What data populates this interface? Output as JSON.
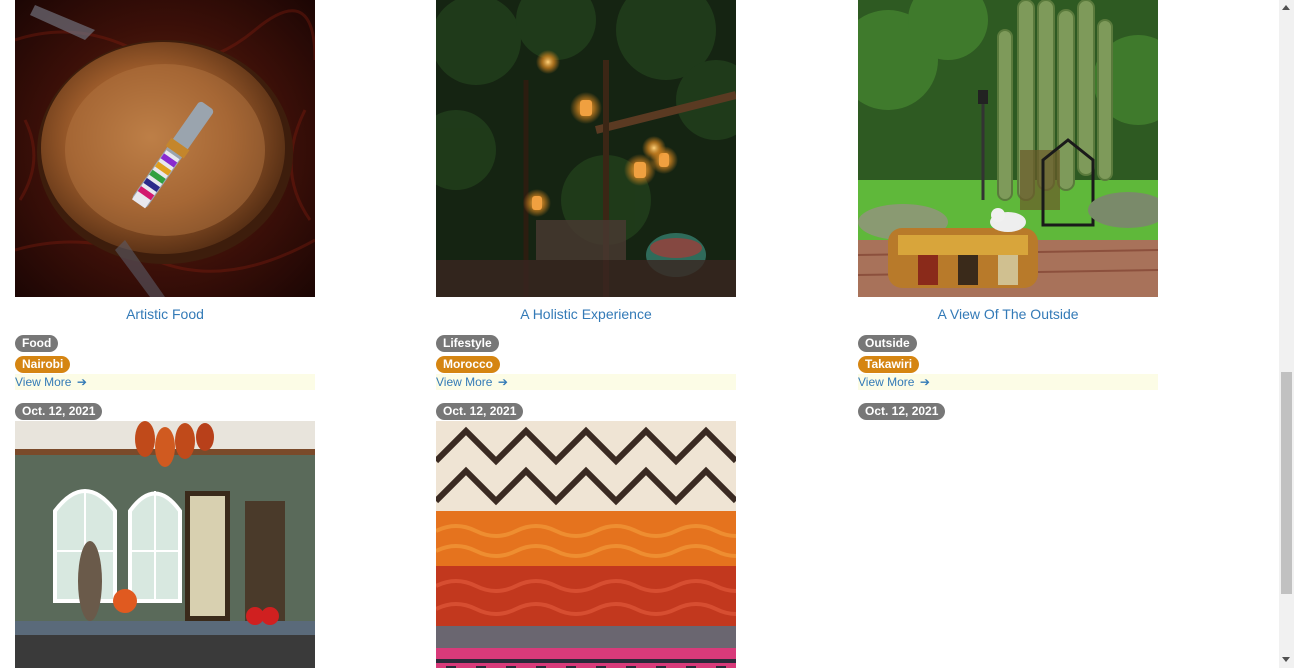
{
  "cards": [
    {
      "title": "Artistic Food",
      "category": "Food",
      "location": "Nairobi",
      "view_more": "View More",
      "date": "Oct. 12, 2021",
      "image": "bowl-with-beaded-forks-photo"
    },
    {
      "title": "A Holistic Experience",
      "category": "Lifestyle",
      "location": "Morocco",
      "view_more": "View More",
      "date": "Oct. 12, 2021",
      "image": "lanterns-at-night-photo"
    },
    {
      "title": "A View Of The Outside",
      "category": "Outside",
      "location": "Takawiri",
      "view_more": "View More",
      "date": "Oct. 12, 2021",
      "image": "garden-cactus-cushions-photo"
    }
  ],
  "next_row_images": [
    "dining-room-interior-photo",
    "woven-textiles-photo"
  ],
  "icons": {
    "view_more": "arrow-right-icon"
  },
  "colors": {
    "link": "#337ab7",
    "badge_gray": "#777777",
    "badge_orange": "#d58512",
    "view_more_bg": "#fcfce6"
  }
}
